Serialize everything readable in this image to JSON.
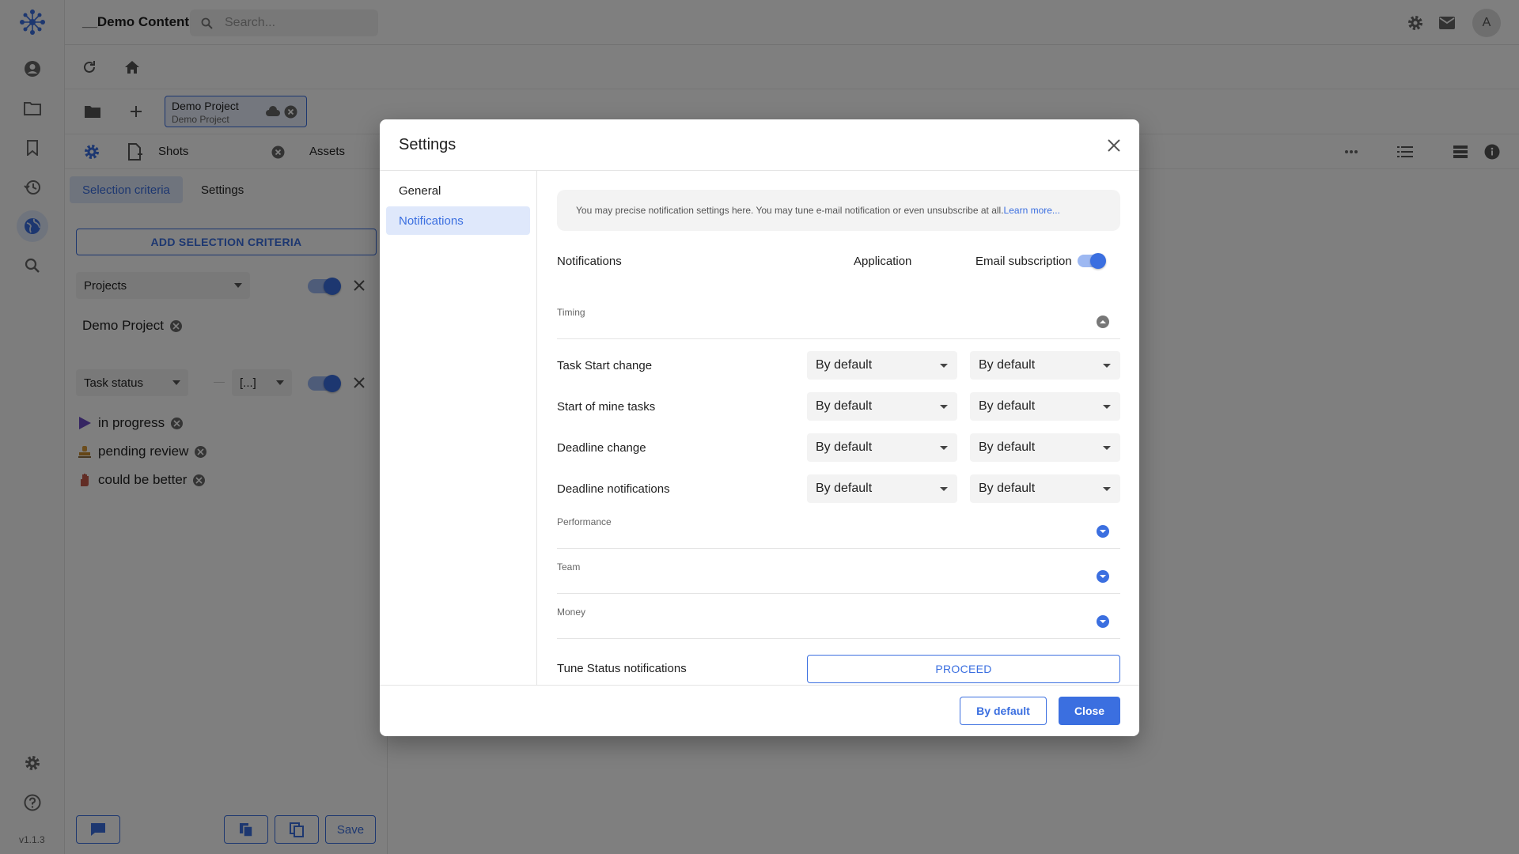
{
  "app": {
    "title": "__Demo Content",
    "version": "v1.1.3",
    "search_placeholder": "Search...",
    "avatar_initial": "A",
    "accent_color": "#3b6fe0"
  },
  "toolbar": {
    "project_chip": {
      "name": "Demo Project",
      "subtitle": "Demo Project"
    },
    "tabs": [
      "Shots",
      "Assets"
    ]
  },
  "left_panel": {
    "subtabs": [
      "Selection criteria",
      "Settings"
    ],
    "add_criteria_label": "ADD SELECTION CRITERIA",
    "projects_filter": {
      "label": "Projects",
      "chips": [
        "Demo Project"
      ],
      "enabled": true
    },
    "status_filter": {
      "label": "Task status",
      "range_label": "[...]",
      "enabled": true,
      "chips": [
        "in progress",
        "pending review",
        "could be better"
      ]
    },
    "save_label": "Save"
  },
  "dialog": {
    "title": "Settings",
    "nav": [
      "General",
      "Notifications"
    ],
    "active_nav": "Notifications",
    "info_text": "You may precise notification settings here. You may tune e-mail notification or even unsubscribe at all.",
    "info_link": "Learn more...",
    "columns": {
      "notifications": "Notifications",
      "application": "Application",
      "email": "Email subscription"
    },
    "email_subscription_enabled": true,
    "sections": {
      "timing": "Timing",
      "performance": "Performance",
      "team": "Team",
      "money": "Money"
    },
    "rows": [
      {
        "label": "Task Start change",
        "application": "By default",
        "email": "By default"
      },
      {
        "label": "Start of mine tasks",
        "application": "By default",
        "email": "By default"
      },
      {
        "label": "Deadline change",
        "application": "By default",
        "email": "By default"
      },
      {
        "label": "Deadline notifications",
        "application": "By default",
        "email": "By default"
      }
    ],
    "tune_status_label": "Tune Status notifications",
    "proceed_label": "PROCEED",
    "by_default_label": "By default",
    "close_label": "Close"
  }
}
